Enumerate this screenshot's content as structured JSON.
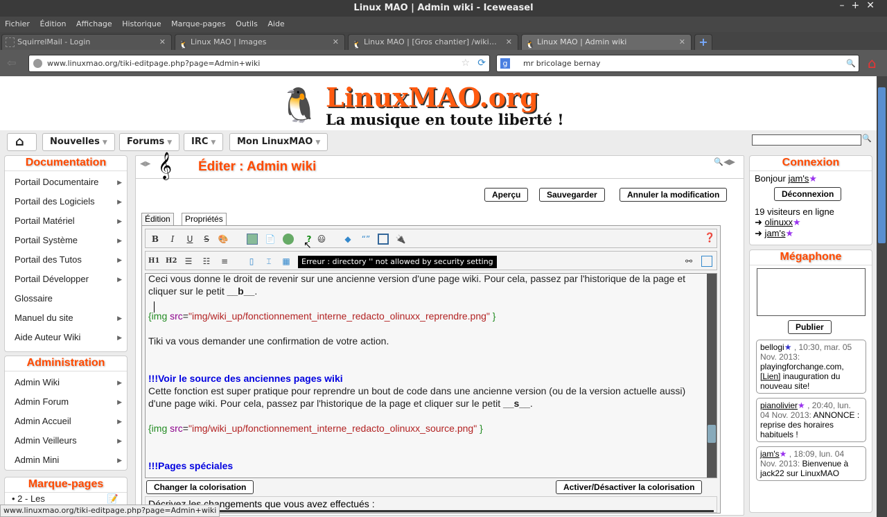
{
  "window": {
    "title": "Linux MAO | Admin wiki - Iceweasel",
    "controls": "–+✕"
  },
  "menu": [
    "Fichier",
    "Édition",
    "Affichage",
    "Historique",
    "Marque-pages",
    "Outils",
    "Aide"
  ],
  "tabs": [
    {
      "label": "SquirrelMail - Login"
    },
    {
      "label": "Linux MAO | Images"
    },
    {
      "label": "Linux MAO | [Gros chantier] /wiki…"
    },
    {
      "label": "Linux MAO | Admin wiki"
    }
  ],
  "nav": {
    "url": "www.linuxmao.org/tiki-editpage.php?page=Admin+wiki",
    "search": "mr bricolage bernay"
  },
  "site": {
    "logo_title": "LinuxMAO.org",
    "logo_tagline": "La musique en toute liberté !",
    "topnav": [
      "Nouvelles",
      "Forums",
      "IRC",
      "Mon LinuxMAO"
    ]
  },
  "left": {
    "doc_title": "Documentation",
    "doc_items": [
      "Portail Documentaire",
      "Portail des Logiciels",
      "Portail Matériel",
      "Portail Système",
      "Portail des Tutos",
      "Portail Développer",
      "Glossaire",
      "Manuel du site",
      "Aide Auteur Wiki"
    ],
    "admin_title": "Administration",
    "admin_items": [
      "Admin Wiki",
      "Admin Forum",
      "Admin Accueil",
      "Admin Veilleurs",
      "Admin Mini"
    ],
    "bookmarks_title": "Marque-pages",
    "bookmark_first": "2 - Les"
  },
  "center": {
    "title": "Éditer : Admin wiki",
    "buttons": {
      "preview": "Aperçu",
      "save": "Sauvegarder",
      "cancel": "Annuler la modification"
    },
    "tabs": [
      "Édition",
      "Propriétés"
    ],
    "tooltip": "Erreur : directory '' not allowed by security setting",
    "editor": {
      "l1": "Ceci vous donne le droit de revenir sur une ancienne version d'une page wiki. Pour cela, passez par l'historique de la page et cliquer sur le petit ",
      "l1b": "__b__",
      "img1": "\"img/wiki_up/fonctionnement_interne_redacto_olinuxx_reprendre.png\"",
      "l2": "Tiki va vous demander une confirmation de votre action.",
      "h1": "!!!Voir le source des anciennes pages wiki",
      "l3": "Cette fonction est super pratique pour reprendre un bout de code dans une ancienne version (ou de la version actuelle aussi) d'une page wiki. Pour cela, passez par l'historique de la page et cliquer sur le petit ",
      "l3b": "__s__",
      "img2": "\"img/wiki_up/fonctionnement_interne_redacto_olinuxx_source.png\"",
      "h2": "!!!Pages spéciales",
      "tok_open": "{img",
      "tok_src": " src",
      "tok_eq": "=",
      "tok_close": " }",
      "period": "."
    },
    "color_btn": "Changer la colorisation",
    "toggle_color_btn": "Activer/Désactiver la colorisation",
    "describe": "Décrivez les changements que vous avez effectués :"
  },
  "right": {
    "login_title": "Connexion",
    "hello": "Bonjour",
    "user": "jam's",
    "logout": "Déconnexion",
    "online": "19 visiteurs en ligne",
    "online_users": [
      "olinuxx",
      "jam's"
    ],
    "mega_title": "Mégaphone",
    "publish": "Publier",
    "messages": [
      {
        "user": "bellogi",
        "meta": ", 10:30, mar. 05 Nov. 2013:",
        "text_a": "playingforchange.com,",
        "link": "[Lien]",
        "text_b": " inauguration du nouveau site!"
      },
      {
        "user": "pianolivier",
        "meta": ", 20:40, lun. 04 Nov. 2013:",
        "text_a": "ANNONCE : reprise des horaires habituels !"
      },
      {
        "user": "jam's",
        "meta": ", 18:09, lun. 04 Nov. 2013:",
        "text_a": "Bienvenue à jack22 sur LinuxMAO"
      }
    ]
  },
  "status": "www.linuxmao.org/tiki-editpage.php?page=Admin+wiki"
}
